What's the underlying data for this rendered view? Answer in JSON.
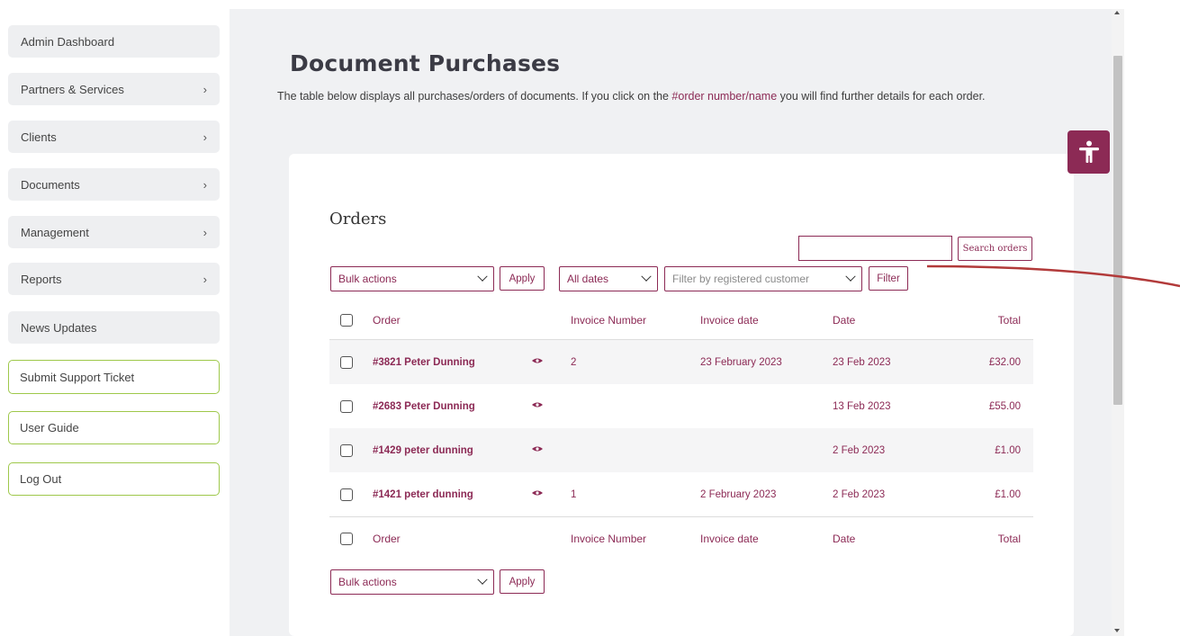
{
  "sidebar": {
    "items": [
      {
        "label": "Admin Dashboard",
        "chevron": ""
      },
      {
        "label": "Partners & Services",
        "chevron": "›"
      },
      {
        "label": "Clients",
        "chevron": "›"
      },
      {
        "label": "Documents",
        "chevron": "›"
      },
      {
        "label": "Management",
        "chevron": "›"
      },
      {
        "label": "Reports",
        "chevron": "›"
      },
      {
        "label": "News Updates",
        "chevron": ""
      }
    ],
    "actions": [
      {
        "label": "Submit Support Ticket"
      },
      {
        "label": "User Guide"
      },
      {
        "label": "Log Out"
      }
    ]
  },
  "page": {
    "title": "Document Purchases",
    "desc_before": "The table below displays all purchases/orders of documents. If you click on the ",
    "desc_highlight": "#order number/name",
    "desc_after": " you will find further details for each order."
  },
  "orders": {
    "heading": "Orders",
    "search_button": "Search orders",
    "search_value": "",
    "bulk_actions": "Bulk actions",
    "apply": "Apply",
    "date_filter": "All dates",
    "customer_filter": "Filter by registered customer",
    "filter_button": "Filter",
    "columns": {
      "order": "Order",
      "invoice_number": "Invoice Number",
      "invoice_date": "Invoice date",
      "date": "Date",
      "total": "Total"
    },
    "rows": [
      {
        "order": "#3821 Peter Dunning",
        "invoice_number": "2",
        "invoice_date": "23 February 2023",
        "date": "23 Feb 2023",
        "total": "£32.00"
      },
      {
        "order": "#2683 Peter Dunning",
        "invoice_number": "",
        "invoice_date": "",
        "date": "13 Feb 2023",
        "total": "£55.00"
      },
      {
        "order": "#1429 peter dunning",
        "invoice_number": "",
        "invoice_date": "",
        "date": "2 Feb 2023",
        "total": "£1.00"
      },
      {
        "order": "#1421 peter dunning",
        "invoice_number": "1",
        "invoice_date": "2 February 2023",
        "date": "2 Feb 2023",
        "total": "£1.00"
      }
    ]
  },
  "colors": {
    "accent": "#8c2a55",
    "outline_green": "#9ec84a",
    "panel_gray": "#f0f1f3"
  },
  "icons": {
    "row_action": "eye-icon",
    "accessibility": "accessibility-icon"
  }
}
